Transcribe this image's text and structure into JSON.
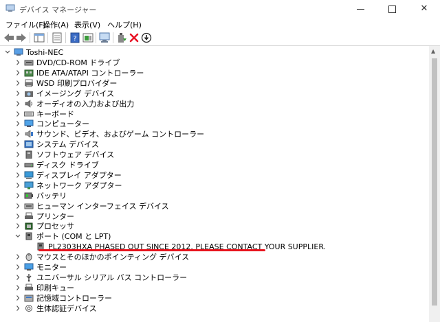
{
  "window": {
    "title": "デバイス マネージャー",
    "minimize_glyph": "—",
    "maximize_glyph": "☐",
    "close_glyph": "✕"
  },
  "menu": [
    "ファイル(F)",
    "操作(A)",
    "表示(V)",
    "ヘルプ(H)"
  ],
  "toolbar_icons": [
    "back-icon",
    "forward-icon",
    "show-hide-console-tree-icon",
    "properties-icon",
    "help-icon",
    "action-pane-icon",
    "scan-hardware-icon",
    "update-driver-icon",
    "uninstall-icon",
    "disable-device-icon"
  ],
  "tree": {
    "root": "Toshi-NEC",
    "items": [
      {
        "label": "DVD/CD-ROM ドライブ",
        "icon": "dvd-drive-icon",
        "expanded": false
      },
      {
        "label": "IDE ATA/ATAPI コントローラー",
        "icon": "ide-controller-icon",
        "expanded": false
      },
      {
        "label": "WSD 印刷プロバイダー",
        "icon": "printer-provider-icon",
        "expanded": false
      },
      {
        "label": "イメージング デバイス",
        "icon": "camera-icon",
        "expanded": false
      },
      {
        "label": "オーディオの入力および出力",
        "icon": "speaker-icon",
        "expanded": false
      },
      {
        "label": "キーボード",
        "icon": "keyboard-icon",
        "expanded": false
      },
      {
        "label": "コンピューター",
        "icon": "computer-icon",
        "expanded": false
      },
      {
        "label": "サウンド、ビデオ、およびゲーム コントローラー",
        "icon": "sound-icon",
        "expanded": false
      },
      {
        "label": "システム デバイス",
        "icon": "system-device-icon",
        "expanded": false
      },
      {
        "label": "ソフトウェア デバイス",
        "icon": "software-device-icon",
        "expanded": false
      },
      {
        "label": "ディスク ドライブ",
        "icon": "disk-drive-icon",
        "expanded": false
      },
      {
        "label": "ディスプレイ アダプター",
        "icon": "display-adapter-icon",
        "expanded": false
      },
      {
        "label": "ネットワーク アダプター",
        "icon": "network-adapter-icon",
        "expanded": false
      },
      {
        "label": "バッテリ",
        "icon": "battery-icon",
        "expanded": false
      },
      {
        "label": "ヒューマン インターフェイス デバイス",
        "icon": "hid-icon",
        "expanded": false
      },
      {
        "label": "プリンター",
        "icon": "printer-icon",
        "expanded": false
      },
      {
        "label": "プロセッサ",
        "icon": "processor-icon",
        "expanded": false
      },
      {
        "label": "ポート (COM と LPT)",
        "icon": "port-icon",
        "expanded": true
      },
      {
        "label": "PL2303HXA PHASED OUT SINCE 2012. PLEASE CONTACT YOUR SUPPLIER.",
        "icon": "port-device-icon",
        "child": true
      },
      {
        "label": "マウスとそのほかのポインティング デバイス",
        "icon": "mouse-icon",
        "expanded": false
      },
      {
        "label": "モニター",
        "icon": "monitor-icon",
        "expanded": false
      },
      {
        "label": "ユニバーサル シリアル バス コントローラー",
        "icon": "usb-icon",
        "expanded": false
      },
      {
        "label": "印刷キュー",
        "icon": "print-queue-icon",
        "expanded": false
      },
      {
        "label": "記憶域コントローラー",
        "icon": "storage-controller-icon",
        "expanded": false
      },
      {
        "label": "生体認証デバイス",
        "icon": "biometric-icon",
        "expanded": false
      }
    ]
  },
  "colors": {
    "highlight_underline": "#e8141d",
    "uninstall_red": "#e81123",
    "folder_blue": "#3a78c8"
  }
}
